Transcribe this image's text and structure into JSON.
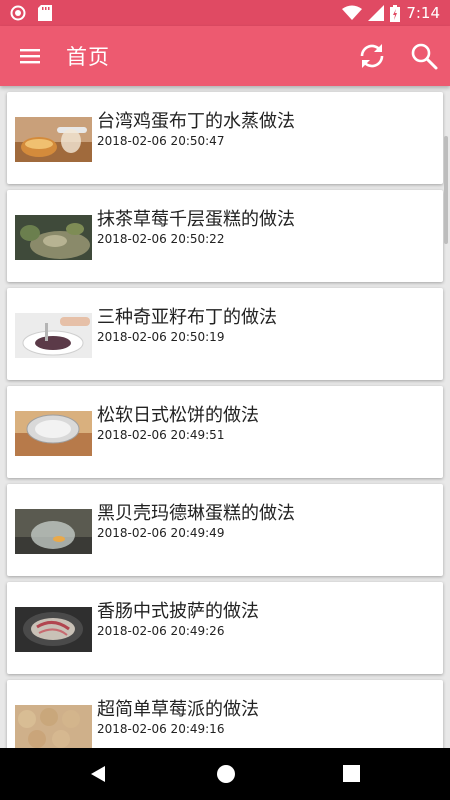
{
  "status_bar": {
    "time": "7:14"
  },
  "app_bar": {
    "title": "首页"
  },
  "items": [
    {
      "title": "台湾鸡蛋布丁的水蒸做法",
      "time": "2018-02-06 20:50:47"
    },
    {
      "title": "抹茶草莓千层蛋糕的做法",
      "time": "2018-02-06 20:50:22"
    },
    {
      "title": "三种奇亚籽布丁的做法",
      "time": "2018-02-06 20:50:19"
    },
    {
      "title": "松软日式松饼的做法",
      "time": "2018-02-06 20:49:51"
    },
    {
      "title": "黑贝壳玛德琳蛋糕的做法",
      "time": "2018-02-06 20:49:49"
    },
    {
      "title": "香肠中式披萨的做法",
      "time": "2018-02-06 20:49:26"
    },
    {
      "title": "超简单草莓派的做法",
      "time": "2018-02-06 20:49:16"
    }
  ],
  "colors": {
    "status_bar": "#e04a63",
    "app_bar": "#ed5a70"
  },
  "icons": [
    "menu-icon",
    "refresh-icon",
    "search-icon",
    "back-icon",
    "home-icon",
    "recents-icon"
  ]
}
